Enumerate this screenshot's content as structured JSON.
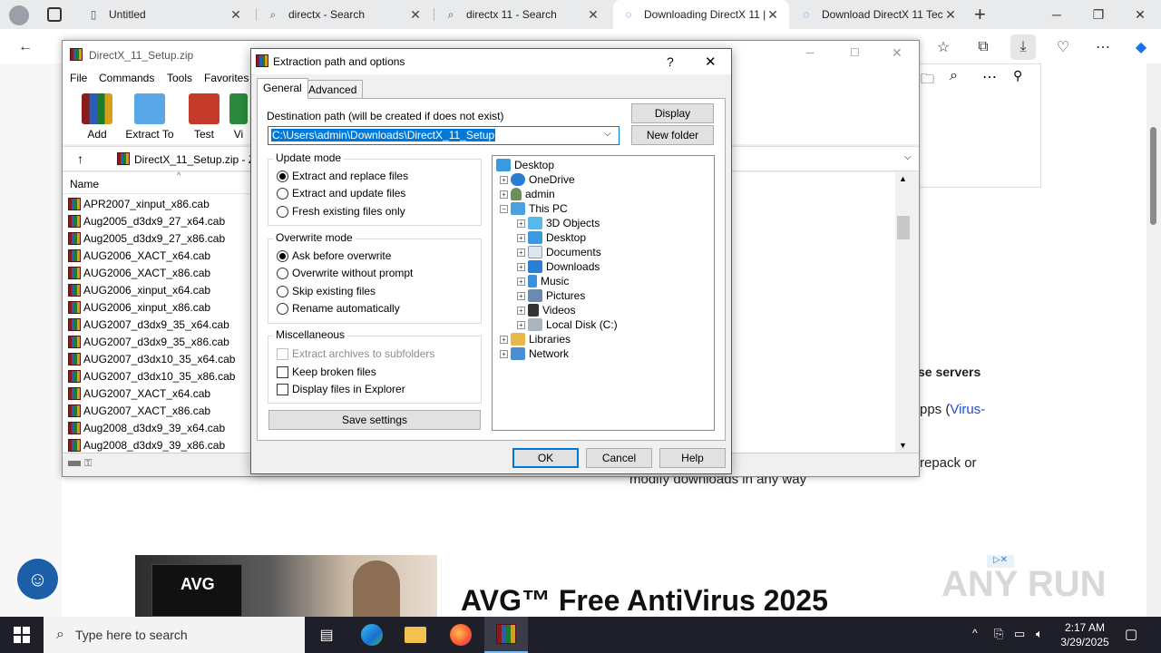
{
  "browser": {
    "tabs": [
      {
        "label": "Untitled",
        "icon": "document-icon",
        "active": false
      },
      {
        "label": "directx - Search",
        "icon": "search-icon",
        "active": false
      },
      {
        "label": "directx 11 - Search",
        "icon": "search-icon",
        "active": false
      },
      {
        "label": "Downloading DirectX 11 |",
        "icon": "loading-icon",
        "active": true
      },
      {
        "label": "Download DirectX 11 Tec",
        "icon": "loading-icon",
        "active": false
      }
    ],
    "new_tab": "+",
    "window_controls": {
      "minimize": "─",
      "maximize": "❐",
      "close": "✕"
    }
  },
  "page": {
    "heading_partial": "se servers",
    "text_apps": "pps (",
    "text_virus": "Virus-",
    "text_repack": "repack or",
    "text_modify": "modify downloads in any way",
    "ad_title": "AVG™ Free AntiVirus 2025",
    "ad_brand": "AVG",
    "watermark": "ANY RUN"
  },
  "winrar": {
    "title": "DirectX_11_Setup.zip",
    "menu": [
      "File",
      "Commands",
      "Tools",
      "Favorites"
    ],
    "tools": [
      "Add",
      "Extract To",
      "Test",
      "Vi"
    ],
    "address": "DirectX_11_Setup.zip - ZI",
    "column_name": "Name",
    "files": [
      "APR2007_xinput_x86.cab",
      "Aug2005_d3dx9_27_x64.cab",
      "Aug2005_d3dx9_27_x86.cab",
      "AUG2006_XACT_x64.cab",
      "AUG2006_XACT_x86.cab",
      "AUG2006_xinput_x64.cab",
      "AUG2006_xinput_x86.cab",
      "AUG2007_d3dx9_35_x64.cab",
      "AUG2007_d3dx9_35_x86.cab",
      "AUG2007_d3dx10_35_x64.cab",
      "AUG2007_d3dx10_35_x86.cab",
      "AUG2007_XACT_x64.cab",
      "AUG2007_XACT_x86.cab",
      "Aug2008_d3dx9_39_x64.cab",
      "Aug2008_d3dx9_39_x86.cab"
    ]
  },
  "dialog": {
    "title": "Extraction path and options",
    "help": "?",
    "close": "✕",
    "tabs": [
      "General",
      "Advanced"
    ],
    "dest_label": "Destination path (will be created if does not exist)",
    "dest_value": "C:\\Users\\admin\\Downloads\\DirectX_11_Setup",
    "display_btn": "Display",
    "newfolder_btn": "New folder",
    "update_mode": {
      "label": "Update mode",
      "options": [
        "Extract and replace files",
        "Extract and update files",
        "Fresh existing files only"
      ],
      "selected": 0
    },
    "overwrite_mode": {
      "label": "Overwrite mode",
      "options": [
        "Ask before overwrite",
        "Overwrite without prompt",
        "Skip existing files",
        "Rename automatically"
      ],
      "selected": 0
    },
    "misc": {
      "label": "Miscellaneous",
      "options": [
        "Extract archives to subfolders",
        "Keep broken files",
        "Display files in Explorer"
      ]
    },
    "save_btn": "Save settings",
    "tree": [
      {
        "label": "Desktop",
        "level": 0,
        "exp": ""
      },
      {
        "label": "OneDrive",
        "level": 1,
        "exp": "+"
      },
      {
        "label": "admin",
        "level": 1,
        "exp": "+"
      },
      {
        "label": "This PC",
        "level": 1,
        "exp": "−"
      },
      {
        "label": "3D Objects",
        "level": 2,
        "exp": "+"
      },
      {
        "label": "Desktop",
        "level": 2,
        "exp": "+"
      },
      {
        "label": "Documents",
        "level": 2,
        "exp": "+"
      },
      {
        "label": "Downloads",
        "level": 2,
        "exp": "+"
      },
      {
        "label": "Music",
        "level": 2,
        "exp": "+"
      },
      {
        "label": "Pictures",
        "level": 2,
        "exp": "+"
      },
      {
        "label": "Videos",
        "level": 2,
        "exp": "+"
      },
      {
        "label": "Local Disk (C:)",
        "level": 2,
        "exp": "+"
      },
      {
        "label": "Libraries",
        "level": 1,
        "exp": "+"
      },
      {
        "label": "Network",
        "level": 1,
        "exp": "+"
      }
    ],
    "ok": "OK",
    "cancel": "Cancel",
    "help_btn": "Help"
  },
  "taskbar": {
    "search_placeholder": "Type here to search",
    "time": "2:17 AM",
    "date": "3/29/2025"
  }
}
